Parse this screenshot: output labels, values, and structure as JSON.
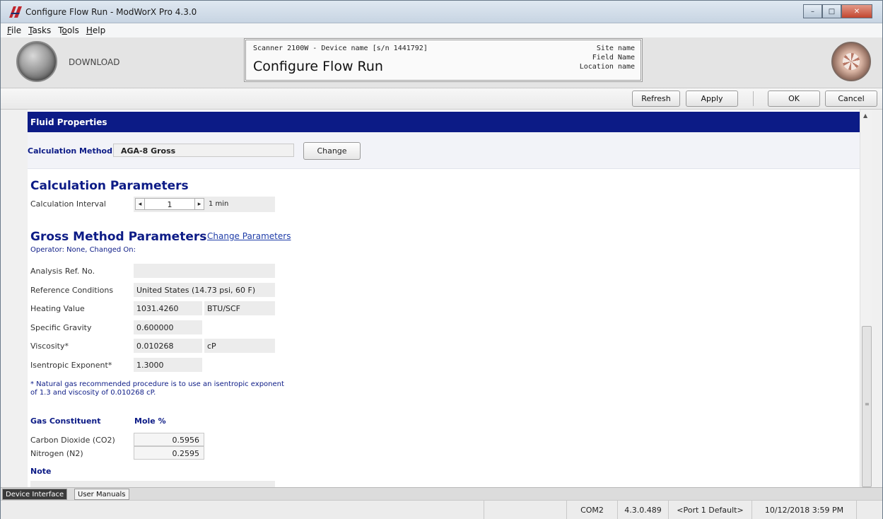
{
  "window": {
    "title": "Configure Flow Run - ModWorX Pro 4.3.0",
    "controls": {
      "minimize": "–",
      "maximize": "□",
      "close": "✕"
    }
  },
  "menu": [
    {
      "label": "File",
      "accel": "F",
      "rest": "ile"
    },
    {
      "label": "Tasks",
      "accel": "T",
      "rest": "asks"
    },
    {
      "label": "Tools",
      "accel": "o",
      "pre": "T",
      "rest": "ols"
    },
    {
      "label": "Help",
      "accel": "H",
      "rest": "elp"
    }
  ],
  "header": {
    "download_label": "DOWNLOAD",
    "device_line": "Scanner 2100W - Device name [s/n 1441792]",
    "page_title": "Configure Flow Run",
    "site_name": "Site name",
    "field_name": "Field Name",
    "location_name": "Location name"
  },
  "toolbar": {
    "refresh": "Refresh",
    "apply": "Apply",
    "ok": "OK",
    "cancel": "Cancel"
  },
  "fluid": {
    "section_title": "Fluid Properties",
    "calc_method_label": "Calculation Method",
    "calc_method_value": "AGA-8 Gross",
    "change_button": "Change"
  },
  "calc_params": {
    "heading": "Calculation Parameters",
    "interval_label": "Calculation Interval",
    "interval_value": "1",
    "interval_unit": "1 min",
    "dec_icon": "◂",
    "inc_icon": "▸"
  },
  "gross": {
    "heading": "Gross Method Parameters",
    "change_link": "Change Parameters",
    "operator_text": "Operator: None, Changed On:",
    "rows": {
      "analysis_label": "Analysis Ref. No.",
      "analysis_value": "",
      "ref_cond_label": "Reference Conditions",
      "ref_cond_value": "United States (14.73 psi, 60 F)",
      "heating_label": "Heating Value",
      "heating_value": "1031.4260",
      "heating_unit": "BTU/SCF",
      "sg_label": "Specific Gravity",
      "sg_value": "0.600000",
      "visc_label": "Viscosity*",
      "visc_value": "0.010268",
      "visc_unit": "cP",
      "isen_label": "Isentropic Exponent*",
      "isen_value": "1.3000"
    },
    "footnote": "* Natural gas recommended procedure is to use an isentropic exponent of 1.3 and viscosity of 0.010268 cP."
  },
  "gas": {
    "col_constituent": "Gas Constituent",
    "col_mole": "Mole %",
    "items": [
      {
        "name": "Carbon Dioxide (CO2)",
        "value": "0.5956"
      },
      {
        "name": "Nitrogen (N2)",
        "value": "0.2595"
      }
    ],
    "note_label": "Note"
  },
  "tabs": {
    "device_interface": "Device Interface",
    "user_manuals": "User Manuals"
  },
  "status": {
    "port": "COM2",
    "version": "4.3.0.489",
    "port_default": "<Port 1 Default>",
    "datetime": "10/12/2018 3:59 PM"
  }
}
